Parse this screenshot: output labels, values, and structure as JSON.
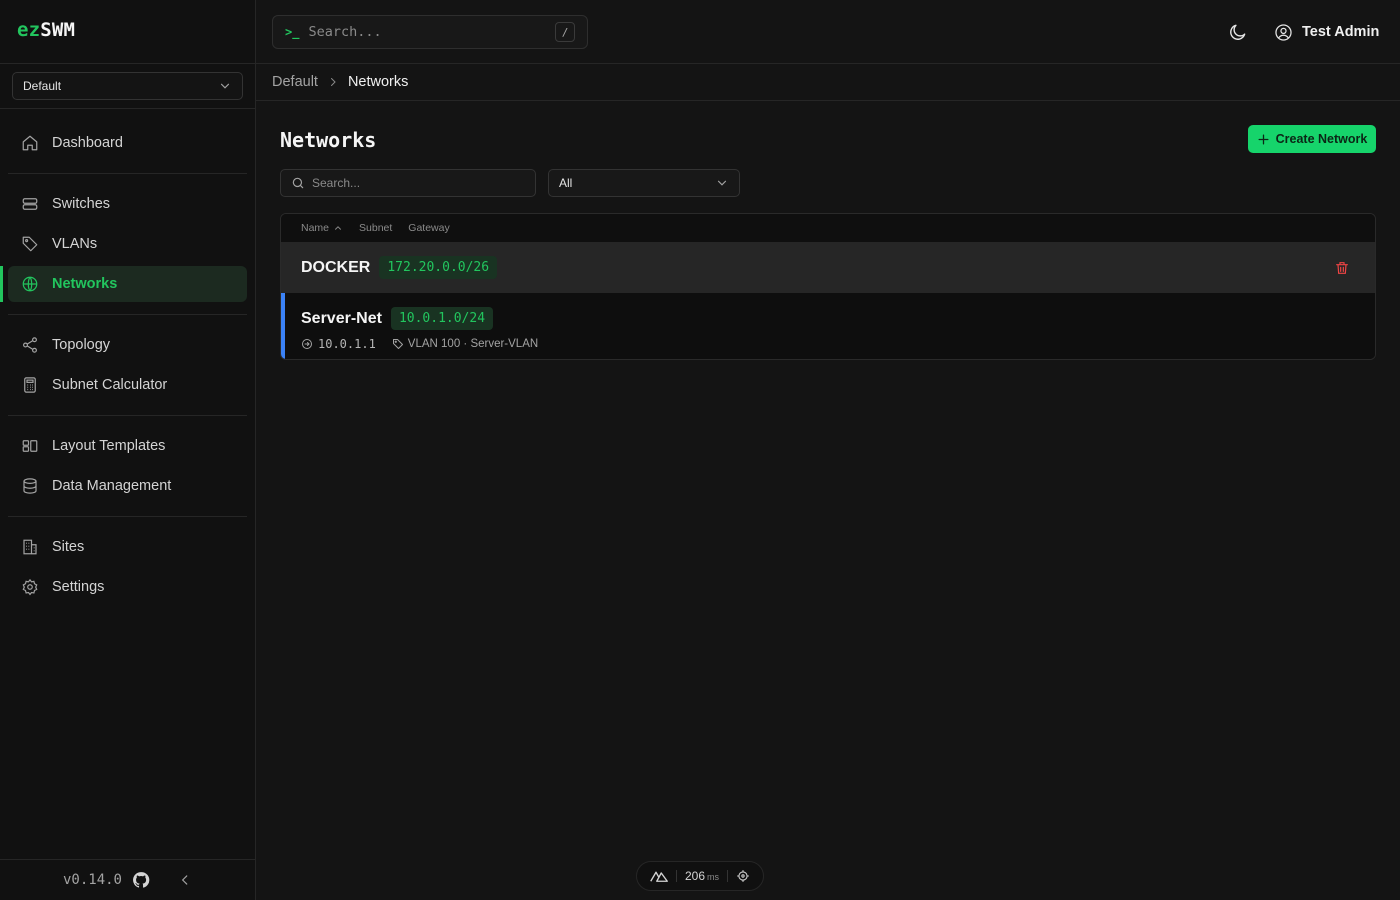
{
  "brand": {
    "ez": "ez",
    "swm": "SWM"
  },
  "org_selector": {
    "value": "Default"
  },
  "nav": {
    "dashboard": "Dashboard",
    "switches": "Switches",
    "vlans": "VLANs",
    "networks": "Networks",
    "topology": "Topology",
    "subnet_calculator": "Subnet Calculator",
    "layout_templates": "Layout Templates",
    "data_management": "Data Management",
    "sites": "Sites",
    "settings": "Settings"
  },
  "footer": {
    "version": "v0.14.0"
  },
  "header": {
    "search_prompt": ">_",
    "search_placeholder": "Search...",
    "search_shortcut": "/",
    "user_name": "Test Admin"
  },
  "breadcrumb": {
    "root": "Default",
    "current": "Networks"
  },
  "page": {
    "title": "Networks",
    "create_button": "Create Network",
    "filter_search_placeholder": "Search...",
    "filter_select_value": "All"
  },
  "table": {
    "columns": {
      "name": "Name",
      "subnet": "Subnet",
      "gateway": "Gateway"
    },
    "rows": [
      {
        "name": "DOCKER",
        "cidr": "172.20.0.0/26"
      },
      {
        "name": "Server-Net",
        "cidr": "10.0.1.0/24",
        "gateway": "10.0.1.1",
        "vlan": "VLAN 100 · Server-VLAN"
      }
    ]
  },
  "dev_pill": {
    "time": "206",
    "unit": "ms"
  },
  "colors": {
    "accent": "#22c55e",
    "button": "#16d46b",
    "danger": "#ef4444",
    "row_accent": "#3b82f6"
  }
}
